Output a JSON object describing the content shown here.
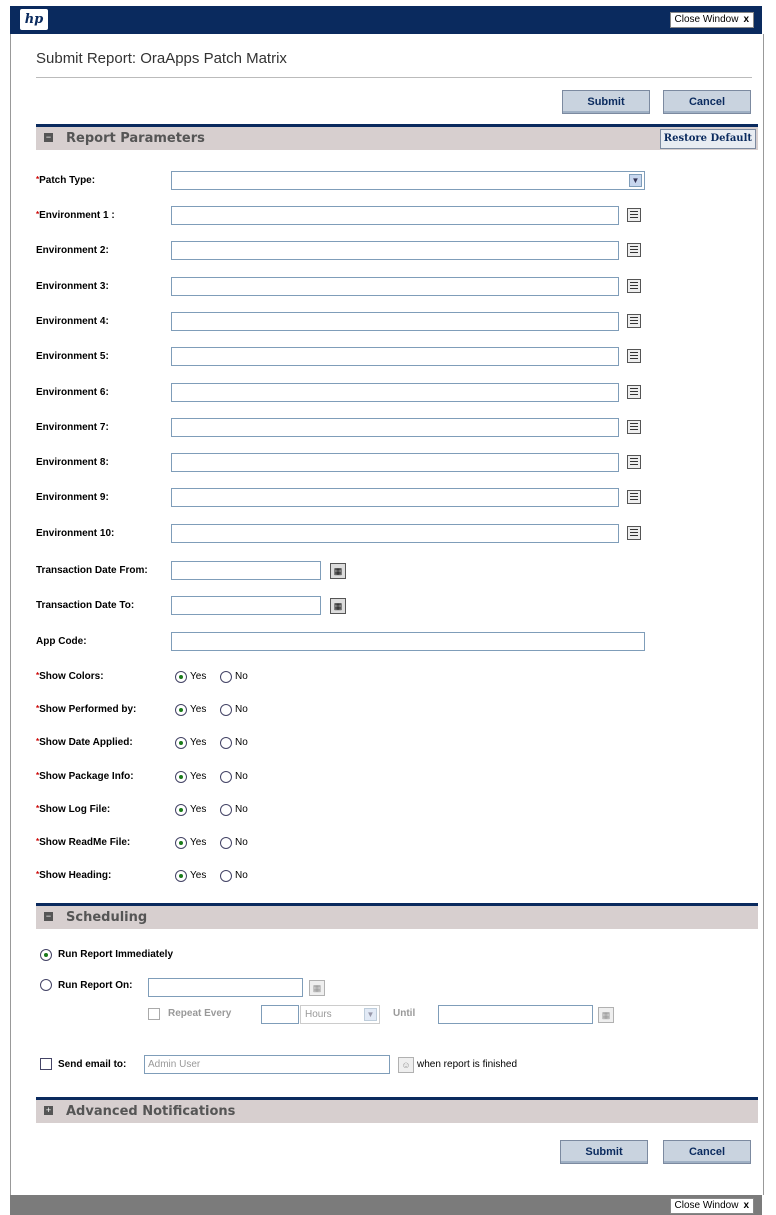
{
  "window": {
    "close_label": "Close Window",
    "close_glyph": "x",
    "logo_text": "hp"
  },
  "page": {
    "title": "Submit Report: OraApps Patch Matrix"
  },
  "buttons": {
    "submit": "Submit",
    "cancel": "Cancel"
  },
  "report_parameters": {
    "title": "Report Parameters",
    "restore_default": "Restore Default",
    "patch_type": {
      "label": "Patch Type:",
      "value": ""
    },
    "environments": [
      {
        "label": "Environment 1 :",
        "required": true,
        "value": ""
      },
      {
        "label": "Environment 2:",
        "required": false,
        "value": ""
      },
      {
        "label": "Environment 3:",
        "required": false,
        "value": ""
      },
      {
        "label": "Environment 4:",
        "required": false,
        "value": ""
      },
      {
        "label": "Environment 5:",
        "required": false,
        "value": ""
      },
      {
        "label": "Environment 6:",
        "required": false,
        "value": ""
      },
      {
        "label": "Environment 7:",
        "required": false,
        "value": ""
      },
      {
        "label": "Environment 8:",
        "required": false,
        "value": ""
      },
      {
        "label": "Environment 9:",
        "required": false,
        "value": ""
      },
      {
        "label": "Environment 10:",
        "required": false,
        "value": ""
      }
    ],
    "transaction_date_from": {
      "label": "Transaction Date From:",
      "value": ""
    },
    "transaction_date_to": {
      "label": "Transaction Date To:",
      "value": ""
    },
    "app_code": {
      "label": "App Code:",
      "value": ""
    },
    "yes_label": "Yes",
    "no_label": "No",
    "toggles": [
      {
        "label": "Show Colors:",
        "selected": "Yes"
      },
      {
        "label": "Show Performed by:",
        "selected": "Yes"
      },
      {
        "label": "Show Date Applied:",
        "selected": "Yes"
      },
      {
        "label": "Show Package Info:",
        "selected": "Yes"
      },
      {
        "label": "Show Log File:",
        "selected": "Yes"
      },
      {
        "label": "Show ReadMe File:",
        "selected": "Yes"
      },
      {
        "label": "Show Heading:",
        "selected": "Yes"
      }
    ]
  },
  "scheduling": {
    "title": "Scheduling",
    "run_immediately": "Run Report Immediately",
    "run_on": "Run Report On:",
    "repeat_every": "Repeat Every",
    "interval_unit": "Hours",
    "until": "Until",
    "send_email": "Send email to:",
    "email_value": "Admin User",
    "when_finished": "when report is finished"
  },
  "advanced_notifications": {
    "title": "Advanced Notifications"
  },
  "colors": {
    "header_navy": "#0a2a5e",
    "section_bg": "#d7cfcf",
    "required_red": "#cc0000",
    "button_bg": "#c9d3df"
  }
}
